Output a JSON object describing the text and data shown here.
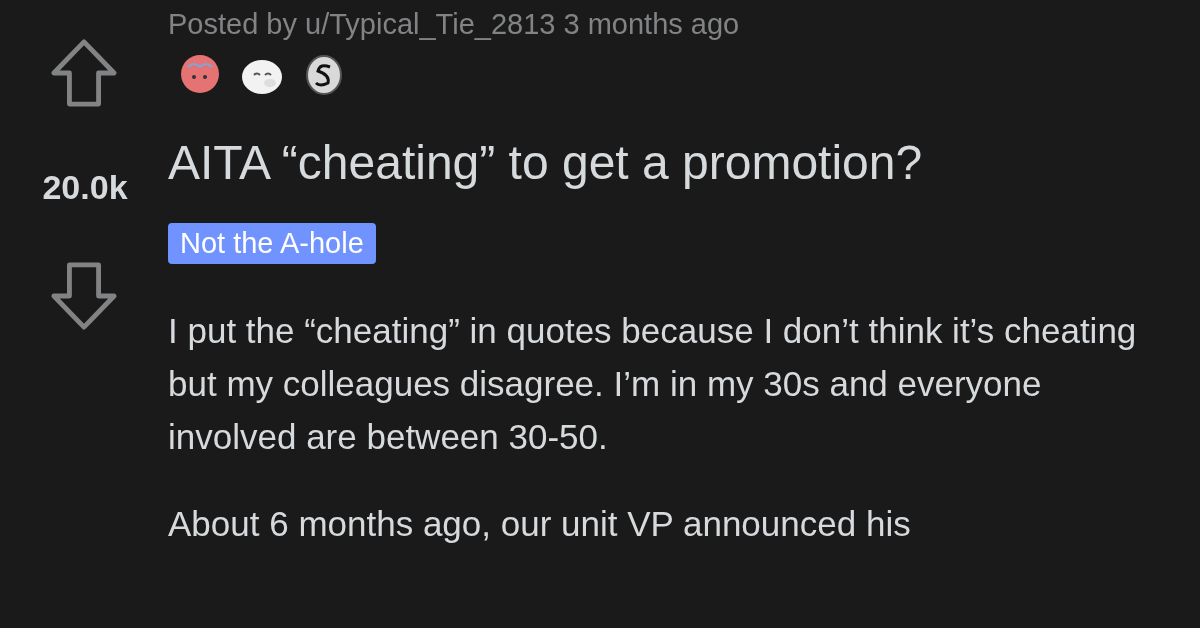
{
  "post": {
    "posted_by": "Posted by u/Typical_Tie_2813 3 months ago",
    "score": "20.0k",
    "title": "AITA “cheating” to get a promotion?",
    "flair": "Not the A-hole",
    "paragraphs": [
      "I put the “cheating” in quotes because I don’t think it’s cheating but my colleagues disagree. I’m in my 30s and everyone involved are between 30-50.",
      "About 6 months ago, our unit VP announced his"
    ]
  }
}
